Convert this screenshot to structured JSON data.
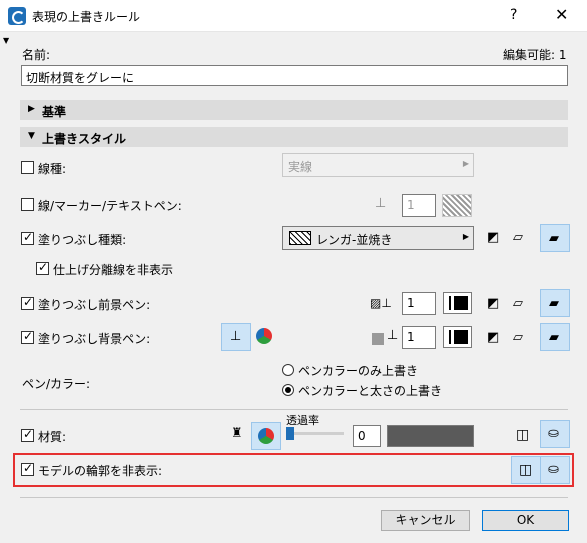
{
  "window": {
    "title": "表現の上書きルール",
    "help": "?",
    "close": "✕"
  },
  "header": {
    "name_label": "名前:",
    "editable_label": "編集可能: 1",
    "name_value": "切断材質をグレーに"
  },
  "sections": {
    "criteria": "基準",
    "override_style": "上書きスタイル"
  },
  "rows": {
    "line_type": {
      "label": "線種:",
      "checked": false,
      "value": "実線"
    },
    "marker_pen": {
      "label": "線/マーカー/テキストペン:",
      "checked": false,
      "pen": "1"
    },
    "fill_type": {
      "label": "塗りつぶし種類:",
      "checked": true,
      "value": "レンガ-並焼き"
    },
    "finish_lines": {
      "label": "仕上げ分離線を非表示",
      "checked": true
    },
    "fill_fg_pen": {
      "label": "塗りつぶし前景ペン:",
      "checked": true,
      "pen": "1"
    },
    "fill_bg_pen": {
      "label": "塗りつぶし背景ペン:",
      "checked": true,
      "pen": "1"
    },
    "pen_color": {
      "label": "ペン/カラー:",
      "option1": "ペンカラーのみ上書き",
      "option2": "ペンカラーと太さの上書き",
      "selected": 2
    },
    "material": {
      "label": "材質:",
      "checked": true,
      "transparency_label": "透過率",
      "transparency": "0"
    },
    "hide_contour": {
      "label": "モデルの輪郭を非表示:",
      "checked": true
    }
  },
  "footer": {
    "cancel": "キャンセル",
    "ok": "OK"
  },
  "colors": {
    "accent": "#0078d7",
    "highlight": "#e53030",
    "material": "#5a5a5a"
  }
}
